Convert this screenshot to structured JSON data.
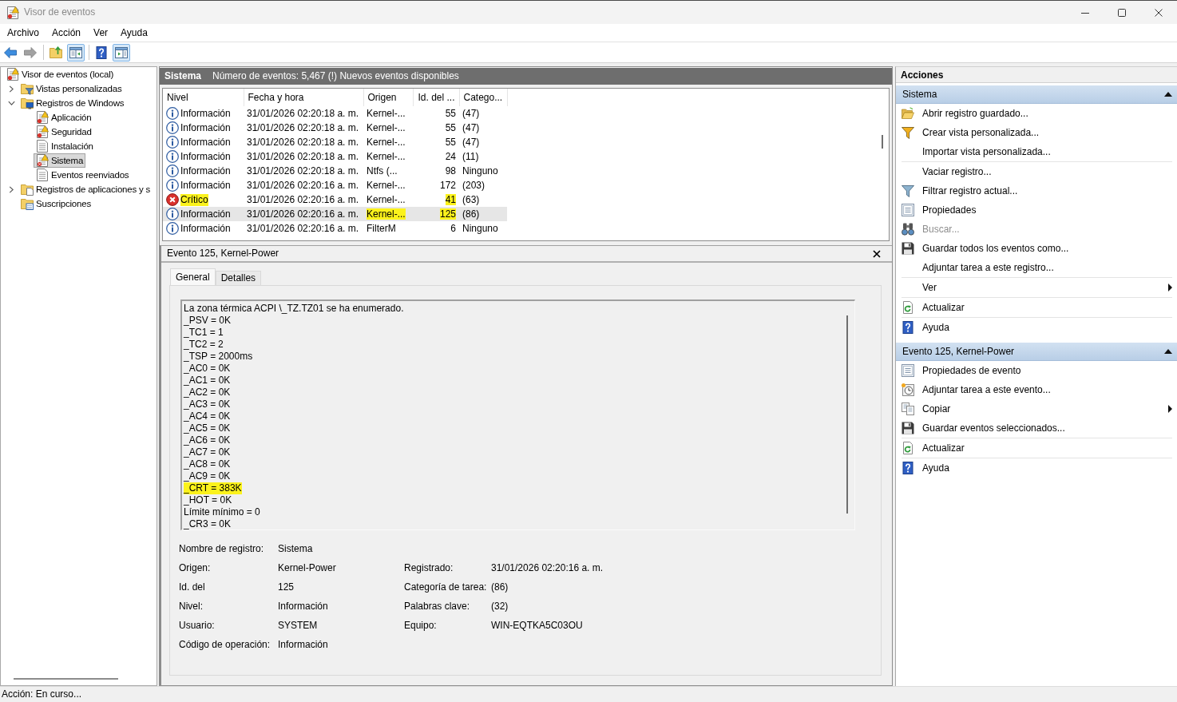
{
  "window": {
    "title": "Visor de eventos"
  },
  "menu": [
    "Archivo",
    "Acción",
    "Ver",
    "Ayuda"
  ],
  "toolbar": [
    {
      "buttons": [
        {
          "kind": "back",
          "selected": false,
          "disabled": false
        },
        {
          "kind": "forward",
          "selected": false,
          "disabled": true
        }
      ]
    },
    {
      "buttons": [
        {
          "kind": "folderup",
          "selected": false,
          "disabled": false
        },
        {
          "kind": "treepane",
          "selected": true,
          "disabled": false
        }
      ]
    },
    {
      "buttons": [
        {
          "kind": "help",
          "selected": false,
          "disabled": false
        },
        {
          "kind": "actionpane",
          "selected": true,
          "disabled": false
        }
      ]
    }
  ],
  "tree": {
    "label": "Visor de eventos (local)",
    "kind": "viewer",
    "selected": false,
    "children": [
      {
        "label": "Vistas personalizadas",
        "kind": "filterfolder",
        "selected": false,
        "expanded": false
      },
      {
        "label": "Registros de Windows",
        "kind": "windowsfolder",
        "selected": false,
        "expanded": true,
        "children": [
          {
            "label": "Aplicación",
            "kind": "alertlog",
            "selected": false
          },
          {
            "label": "Seguridad",
            "kind": "alertlog",
            "selected": false
          },
          {
            "label": "Instalación",
            "kind": "plainlog",
            "selected": false
          },
          {
            "label": "Sistema",
            "kind": "systemlog",
            "selected": true
          },
          {
            "label": "Eventos reenviados",
            "kind": "plainlog",
            "selected": false
          }
        ]
      },
      {
        "label": "Registros de aplicaciones y s",
        "kind": "appfolder",
        "selected": false,
        "expanded": false
      },
      {
        "label": "Suscripciones",
        "kind": "subscriptions",
        "selected": false
      }
    ]
  },
  "events_panel": {
    "title": "Sistema",
    "summary": "Número de eventos: 5,467 (!) Nuevos eventos disponibles",
    "columns": [
      "Nivel",
      "Fecha y hora",
      "Origen",
      "Id. del ...",
      "Catego..."
    ],
    "rows": [
      {
        "kind": "info",
        "selected": false,
        "cells": [
          {
            "text": "Información",
            "highlighted": false
          },
          {
            "text": "31/01/2026 02:20:18 a. m.",
            "highlighted": false
          },
          {
            "text": "Kernel-...",
            "highlighted": false
          },
          {
            "text": "55",
            "highlighted": false
          },
          {
            "text": "(47)",
            "highlighted": false
          }
        ]
      },
      {
        "kind": "info",
        "selected": false,
        "cells": [
          {
            "text": "Información",
            "highlighted": false
          },
          {
            "text": "31/01/2026 02:20:18 a. m.",
            "highlighted": false
          },
          {
            "text": "Kernel-...",
            "highlighted": false
          },
          {
            "text": "55",
            "highlighted": false
          },
          {
            "text": "(47)",
            "highlighted": false
          }
        ]
      },
      {
        "kind": "info",
        "selected": false,
        "cells": [
          {
            "text": "Información",
            "highlighted": false
          },
          {
            "text": "31/01/2026 02:20:18 a. m.",
            "highlighted": false
          },
          {
            "text": "Kernel-...",
            "highlighted": false
          },
          {
            "text": "55",
            "highlighted": false
          },
          {
            "text": "(47)",
            "highlighted": false
          }
        ]
      },
      {
        "kind": "info",
        "selected": false,
        "cells": [
          {
            "text": "Información",
            "highlighted": false
          },
          {
            "text": "31/01/2026 02:20:18 a. m.",
            "highlighted": false
          },
          {
            "text": "Kernel-...",
            "highlighted": false
          },
          {
            "text": "24",
            "highlighted": false
          },
          {
            "text": "(11)",
            "highlighted": false
          }
        ]
      },
      {
        "kind": "info",
        "selected": false,
        "cells": [
          {
            "text": "Información",
            "highlighted": false
          },
          {
            "text": "31/01/2026 02:20:18 a. m.",
            "highlighted": false
          },
          {
            "text": "Ntfs (...",
            "highlighted": false
          },
          {
            "text": "98",
            "highlighted": false
          },
          {
            "text": "Ninguno",
            "highlighted": false
          }
        ]
      },
      {
        "kind": "info",
        "selected": false,
        "cells": [
          {
            "text": "Información",
            "highlighted": false
          },
          {
            "text": "31/01/2026 02:20:16 a. m.",
            "highlighted": false
          },
          {
            "text": "Kernel-...",
            "highlighted": false
          },
          {
            "text": "172",
            "highlighted": false
          },
          {
            "text": "(203)",
            "highlighted": false
          }
        ]
      },
      {
        "kind": "critical",
        "selected": false,
        "cells": [
          {
            "text": "Crítico",
            "highlighted": true
          },
          {
            "text": "31/01/2026 02:20:16 a. m.",
            "highlighted": false
          },
          {
            "text": "Kernel-...",
            "highlighted": false
          },
          {
            "text": "41",
            "highlighted": true
          },
          {
            "text": "(63)",
            "highlighted": false
          }
        ]
      },
      {
        "kind": "info",
        "selected": true,
        "cells": [
          {
            "text": "Información",
            "highlighted": false
          },
          {
            "text": "31/01/2026 02:20:16 a. m.",
            "highlighted": false
          },
          {
            "text": "Kernel-...",
            "highlighted": true
          },
          {
            "text": "125",
            "highlighted": true
          },
          {
            "text": "(86)",
            "highlighted": false
          }
        ]
      },
      {
        "kind": "info",
        "selected": false,
        "cells": [
          {
            "text": "Información",
            "highlighted": false
          },
          {
            "text": "31/01/2026 02:20:16 a. m.",
            "highlighted": false
          },
          {
            "text": "FilterM",
            "highlighted": false
          },
          {
            "text": "6",
            "highlighted": false
          },
          {
            "text": "Ninguno",
            "highlighted": false
          }
        ]
      }
    ]
  },
  "event_detail": {
    "title": "Evento 125, Kernel-Power",
    "tabs": [
      {
        "label": "General",
        "selected": true
      },
      {
        "label": "Detalles",
        "selected": false
      }
    ],
    "description": [
      {
        "text": "La zona térmica ACPI \\_TZ.TZ01 se ha enumerado.",
        "highlighted": false
      },
      {
        "text": "_PSV = 0K",
        "highlighted": false
      },
      {
        "text": "_TC1 = 1",
        "highlighted": false
      },
      {
        "text": "_TC2 = 2",
        "highlighted": false
      },
      {
        "text": "_TSP = 2000ms",
        "highlighted": false
      },
      {
        "text": "_AC0 = 0K",
        "highlighted": false
      },
      {
        "text": "_AC1 = 0K",
        "highlighted": false
      },
      {
        "text": "_AC2 = 0K",
        "highlighted": false
      },
      {
        "text": "_AC3 = 0K",
        "highlighted": false
      },
      {
        "text": "_AC4 = 0K",
        "highlighted": false
      },
      {
        "text": "_AC5 = 0K",
        "highlighted": false
      },
      {
        "text": "_AC6 = 0K",
        "highlighted": false
      },
      {
        "text": "_AC7 = 0K",
        "highlighted": false
      },
      {
        "text": "_AC8 = 0K",
        "highlighted": false
      },
      {
        "text": "_AC9 = 0K",
        "highlighted": false
      },
      {
        "text": "_CRT = 383K",
        "highlighted": true
      },
      {
        "text": "_HOT = 0K",
        "highlighted": false
      },
      {
        "text": "Límite mínimo = 0",
        "highlighted": false
      },
      {
        "text": "_CR3 = 0K",
        "highlighted": false
      }
    ],
    "property_rows": [
      [
        {
          "label": "Nombre de registro:",
          "value": "Sistema"
        }
      ],
      [
        {
          "label": "Origen:",
          "value": "Kernel-Power"
        },
        {
          "label": "Registrado:",
          "value": "31/01/2026 02:20:16 a. m."
        }
      ],
      [
        {
          "label": "Id. del",
          "value": "125"
        },
        {
          "label": "Categoría de tarea:",
          "value": "(86)"
        }
      ],
      [
        {
          "label": "Nivel:",
          "value": "Información"
        },
        {
          "label": "Palabras clave:",
          "value": "(32)"
        }
      ],
      [
        {
          "label": "Usuario:",
          "value": "SYSTEM"
        },
        {
          "label": "Equipo:",
          "value": "WIN-EQTKA5C03OU"
        }
      ],
      [
        {
          "label": "Código de operación:",
          "value": "Información"
        }
      ]
    ]
  },
  "actions": {
    "title": "Acciones",
    "sections": [
      {
        "title": "Sistema",
        "expanded": true,
        "groups": [
          {
            "items": [
              {
                "kind": "open",
                "label": "Abrir registro guardado...",
                "disabled": false,
                "submenu": false
              },
              {
                "kind": "newview",
                "label": "Crear vista personalizada...",
                "disabled": false,
                "submenu": false
              },
              {
                "kind": "plain",
                "label": "Importar vista personalizada...",
                "disabled": false,
                "submenu": false
              }
            ]
          },
          {
            "items": [
              {
                "kind": "plain",
                "label": "Vaciar registro...",
                "disabled": false,
                "submenu": false
              },
              {
                "kind": "filter",
                "label": "Filtrar registro actual...",
                "disabled": false,
                "submenu": false
              },
              {
                "kind": "properties",
                "label": "Propiedades",
                "disabled": false,
                "submenu": false
              },
              {
                "kind": "find",
                "label": "Buscar...",
                "disabled": true,
                "submenu": false
              },
              {
                "kind": "save",
                "label": "Guardar todos los eventos como...",
                "disabled": false,
                "submenu": false
              },
              {
                "kind": "plain",
                "label": "Adjuntar tarea a este registro...",
                "disabled": false,
                "submenu": false
              }
            ]
          },
          {
            "items": [
              {
                "kind": "plain",
                "label": "Ver",
                "disabled": false,
                "submenu": true
              }
            ]
          },
          {
            "items": [
              {
                "kind": "refresh",
                "label": "Actualizar",
                "disabled": false,
                "submenu": false
              }
            ]
          },
          {
            "items": [
              {
                "kind": "help",
                "label": "Ayuda",
                "disabled": false,
                "submenu": false
              }
            ]
          }
        ]
      },
      {
        "title": "Evento 125, Kernel-Power",
        "expanded": true,
        "groups": [
          {
            "items": [
              {
                "kind": "properties",
                "label": "Propiedades de evento",
                "disabled": false,
                "submenu": false
              },
              {
                "kind": "task",
                "label": "Adjuntar tarea a este evento...",
                "disabled": false,
                "submenu": false
              },
              {
                "kind": "copy",
                "label": "Copiar",
                "disabled": false,
                "submenu": true
              },
              {
                "kind": "save",
                "label": "Guardar eventos seleccionados...",
                "disabled": false,
                "submenu": false
              }
            ]
          },
          {
            "items": [
              {
                "kind": "refresh",
                "label": "Actualizar",
                "disabled": false,
                "submenu": false
              }
            ]
          },
          {
            "items": [
              {
                "kind": "help",
                "label": "Ayuda",
                "disabled": false,
                "submenu": false
              }
            ]
          }
        ]
      }
    ]
  },
  "status_bar": {
    "text": "Acción: En curso..."
  }
}
